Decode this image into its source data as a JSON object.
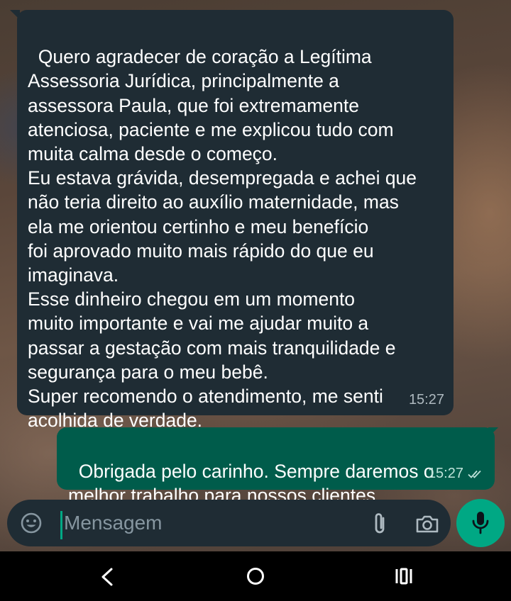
{
  "conversation": {
    "messages": [
      {
        "direction": "incoming",
        "text": "Quero agradecer de coração a Legítima\nAssessoria Jurídica, principalmente a\nassessora Paula, que foi extremamente\natenciosa, paciente e me explicou tudo com\nmuita calma desde o começo.\nEu estava grávida, desempregada e achei que\nnão teria direito ao auxílio maternidade, mas\nela me orientou certinho e meu benefício\nfoi aprovado muito mais rápido do que eu\nimaginava.\nEsse dinheiro chegou em um momento\nmuito importante e vai me ajudar muito a\npassar a gestação com mais tranquilidade e\nsegurança para o meu bebê.\nSuper recomendo o atendimento, me senti\nacolhida de verdade.",
        "time": "15:27"
      },
      {
        "direction": "outgoing",
        "text": "Obrigada pelo carinho. Sempre daremos o\nmelhor trabalho para nossos clientes.",
        "time": "15:27",
        "status_icon": "double-check-icon"
      }
    ]
  },
  "composer": {
    "placeholder": "Mensagem",
    "icons": [
      "emoji-icon",
      "attach-icon",
      "camera-icon",
      "mic-icon"
    ]
  },
  "navbar": {
    "icons": [
      "back-icon",
      "home-icon",
      "recents-icon"
    ]
  },
  "colors": {
    "incoming_bubble": "#1f2c34",
    "outgoing_bubble": "#005c4b",
    "accent": "#00a884"
  }
}
